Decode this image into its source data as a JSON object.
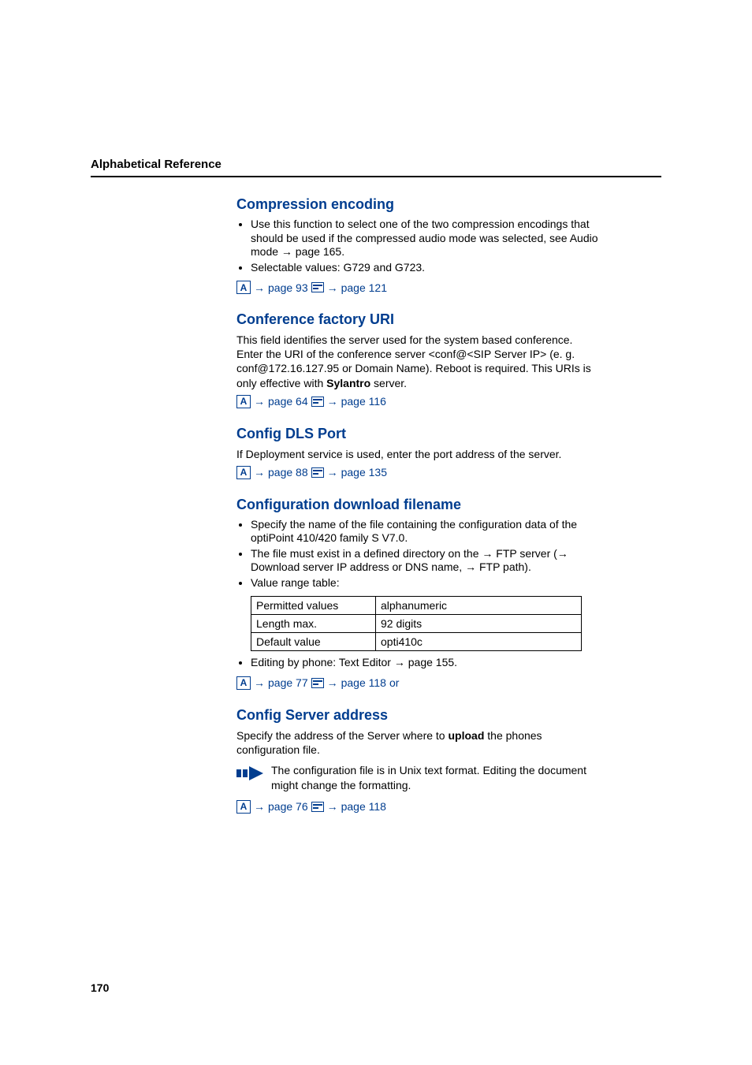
{
  "header": {
    "title": "Alphabetical Reference"
  },
  "page_number": "170",
  "ref_labels": {
    "to": "→",
    "page_word": "page",
    "or": " or"
  },
  "sections": {
    "compression": {
      "title": "Compression encoding",
      "bullets": [
        "Use this function to select one of the two compression encodings that should be used if the compressed audio mode was selected, see Audio mode → page 165.",
        "Selectable values: G729 and G723."
      ],
      "ref_a": "page 93",
      "ref_b": "page 121"
    },
    "conference": {
      "title": "Conference factory URI",
      "body_parts": {
        "p1": "This field identifies the server used for the system based conference.  Enter the URI of the conference server <conf@<SIP Server IP>  (e. g.  conf@172.16.127.95 or Domain Name). Reboot is required. This URIs is only effective with ",
        "bold": "Sylantro",
        "p2": " server."
      },
      "ref_a": "page 64",
      "ref_b": "page 116"
    },
    "dls": {
      "title": "Config DLS Port",
      "body": "If Deployment service is used, enter the port address of the server.",
      "ref_a": "page 88",
      "ref_b": "page 135"
    },
    "download": {
      "title": "Configuration download filename",
      "bullets_top": [
        "Specify the name of the file containing the configuration data of the optiPoint 410/420 family S V7.0.",
        "The file must exist in a defined directory on the → FTP server (→ Download server IP address or DNS name, → FTP path).",
        "Value range table:"
      ],
      "table": {
        "r1c1": "Permitted values",
        "r1c2": "alphanumeric",
        "r2c1": "Length max.",
        "r2c2": "92 digits",
        "r3c1": "Default value",
        "r3c2": "opti410c"
      },
      "bullet_after": "Editing by phone: Text Editor → page 155.",
      "ref_a": "page 77",
      "ref_b": "page 118"
    },
    "server": {
      "title": "Config Server address",
      "body_parts": {
        "p1": "Specify the address of the Server where to ",
        "bold": "upload",
        "p2": " the phones configuration file."
      },
      "note": "The configuration file is in Unix text format. Editing the document might change the formatting.",
      "ref_a": "page 76",
      "ref_b": "page 118"
    }
  }
}
